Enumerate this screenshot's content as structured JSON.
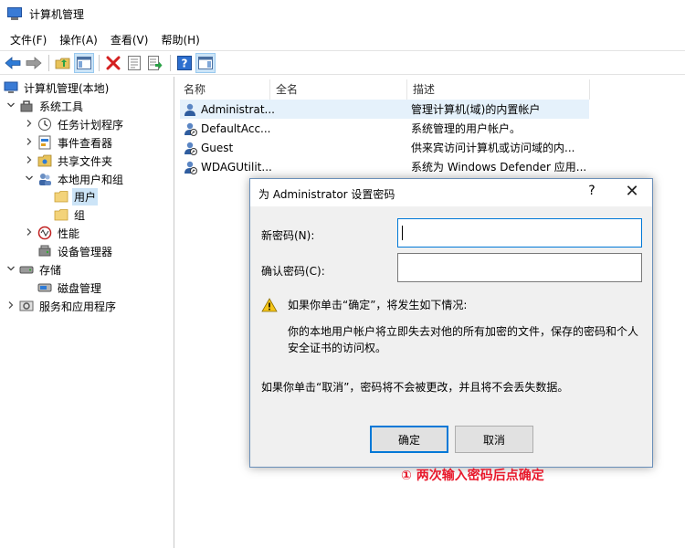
{
  "window": {
    "title": "计算机管理"
  },
  "menu": [
    "文件(F)",
    "操作(A)",
    "查看(V)",
    "帮助(H)"
  ],
  "tree": [
    {
      "label": "计算机管理(本地)",
      "chev": "",
      "icon": "computer-management-icon",
      "level": 0,
      "selected": false
    },
    {
      "label": "系统工具",
      "chev": "v",
      "icon": "system-tools-icon",
      "level": 1,
      "selected": false
    },
    {
      "label": "任务计划程序",
      "chev": ">",
      "icon": "task-scheduler-icon",
      "level": 2,
      "selected": false
    },
    {
      "label": "事件查看器",
      "chev": ">",
      "icon": "event-viewer-icon",
      "level": 2,
      "selected": false
    },
    {
      "label": "共享文件夹",
      "chev": ">",
      "icon": "shared-folder-icon",
      "level": 2,
      "selected": false
    },
    {
      "label": "本地用户和组",
      "chev": "v",
      "icon": "local-users-groups-icon",
      "level": 2,
      "selected": false
    },
    {
      "label": "用户",
      "chev": "",
      "icon": "folder-icon",
      "level": 3,
      "selected": true
    },
    {
      "label": "组",
      "chev": "",
      "icon": "folder-icon",
      "level": 3,
      "selected": false
    },
    {
      "label": "性能",
      "chev": ">",
      "icon": "performance-icon",
      "level": 2,
      "selected": false
    },
    {
      "label": "设备管理器",
      "chev": "",
      "icon": "device-manager-icon",
      "level": 2,
      "selected": false
    },
    {
      "label": "存储",
      "chev": "v",
      "icon": "storage-icon",
      "level": 1,
      "selected": false
    },
    {
      "label": "磁盘管理",
      "chev": "",
      "icon": "disk-management-icon",
      "level": 2,
      "selected": false
    },
    {
      "label": "服务和应用程序",
      "chev": ">",
      "icon": "services-apps-icon",
      "level": 1,
      "selected": false
    }
  ],
  "list": {
    "columns": [
      "名称",
      "全名",
      "描述"
    ],
    "rows": [
      {
        "name": "Administrat...",
        "fullname": "",
        "desc": "管理计算机(域)的内置帐户",
        "selected": true
      },
      {
        "name": "DefaultAcc...",
        "fullname": "",
        "desc": "系统管理的用户帐户。",
        "selected": false
      },
      {
        "name": "Guest",
        "fullname": "",
        "desc": "供来宾访问计算机或访问域的内...",
        "selected": false
      },
      {
        "name": "WDAGUtilit...",
        "fullname": "",
        "desc": "系统为 Windows Defender 应用...",
        "selected": false
      }
    ]
  },
  "dialog": {
    "title": "为 Administrator 设置密码",
    "help": "?",
    "close": "✕",
    "new_password_label": "新密码(N):",
    "confirm_password_label": "确认密码(C):",
    "new_password_value": "",
    "confirm_password_value": "",
    "warning_heading": "如果你单击“确定”，将发生如下情况:",
    "warning_line1": "你的本地用户帐户将立即失去对他的所有加密的文件，保存的密码和个人",
    "warning_line2": "安全证书的访问权。",
    "cancel_note": "如果你单击“取消”，密码将不会被更改，并且将不会丢失数据。",
    "ok_label": "确定",
    "cancel_label": "取消"
  },
  "annotation": "① 两次输入密码后点确定",
  "colors": {
    "accent": "#0078d7",
    "annotation": "#e8192c",
    "selection": "#cce4f7"
  }
}
